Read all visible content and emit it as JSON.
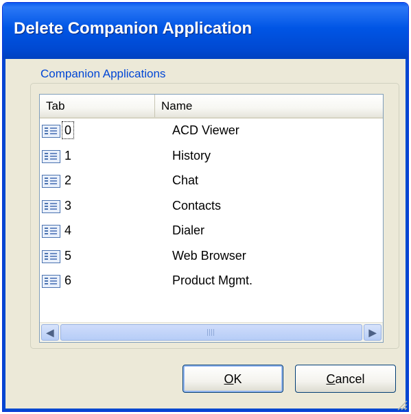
{
  "dialog": {
    "title": "Delete Companion Application",
    "group_label": "Companion Applications"
  },
  "list": {
    "columns": {
      "tab": "Tab",
      "name": "Name"
    },
    "rows": [
      {
        "tab": "0",
        "name": "ACD Viewer",
        "icon": "application-icon"
      },
      {
        "tab": "1",
        "name": "History",
        "icon": "application-icon"
      },
      {
        "tab": "2",
        "name": "Chat",
        "icon": "application-icon"
      },
      {
        "tab": "3",
        "name": "Contacts",
        "icon": "application-icon"
      },
      {
        "tab": "4",
        "name": "Dialer",
        "icon": "application-icon"
      },
      {
        "tab": "5",
        "name": "Web Browser",
        "icon": "application-icon"
      },
      {
        "tab": "6",
        "name": "Product Mgmt.",
        "icon": "application-icon"
      }
    ],
    "focused_row": "0"
  },
  "buttons": {
    "ok_mnemonic": "O",
    "ok_rest": "K",
    "cancel_mnemonic": "C",
    "cancel_rest": "ancel"
  },
  "colors": {
    "titlebar": "#0055e5",
    "group_label": "#0046d5",
    "dialog_background": "#ece9d8"
  }
}
